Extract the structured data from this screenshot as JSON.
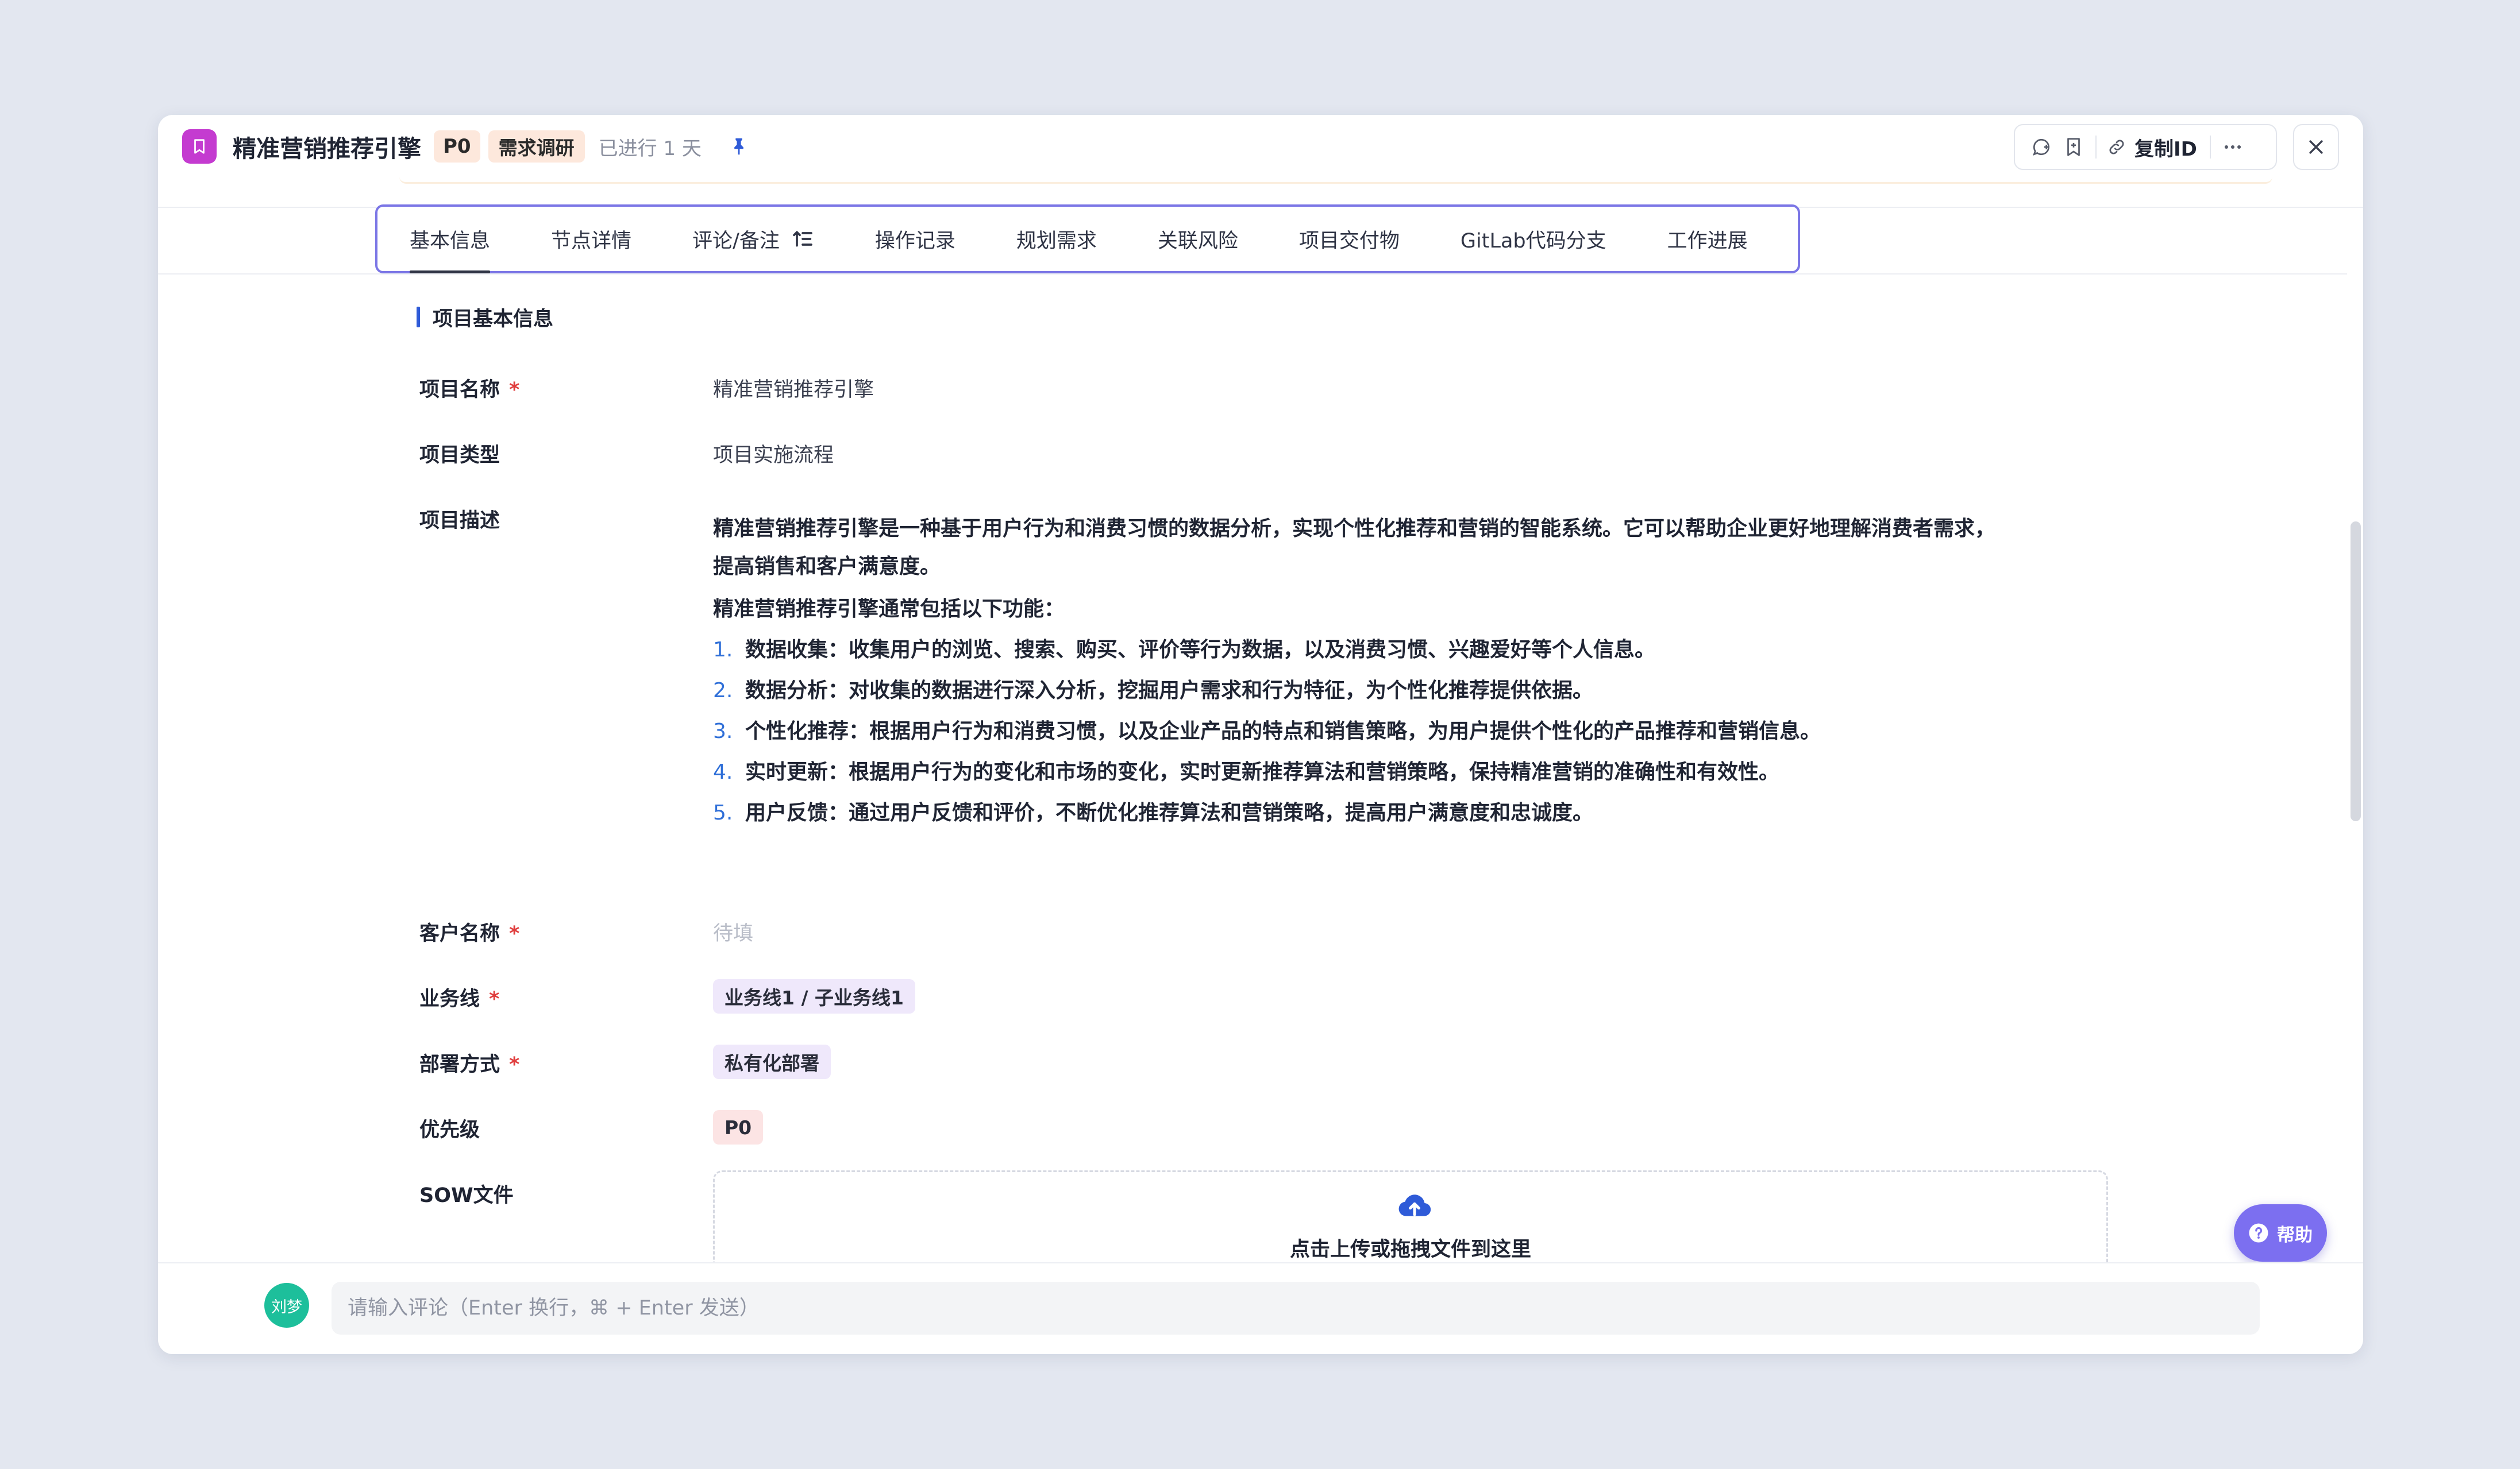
{
  "header": {
    "title": "精准营销推荐引擎",
    "priority_tag": "P0",
    "stage_tag": "需求调研",
    "elapsed": "已进行 1 天",
    "copy_id_label": "复制ID"
  },
  "tabs": [
    {
      "label": "基本信息",
      "active": true
    },
    {
      "label": "节点详情"
    },
    {
      "label": "评论/备注"
    },
    {
      "label": "操作记录"
    },
    {
      "label": "规划需求"
    },
    {
      "label": "关联风险"
    },
    {
      "label": "项目交付物"
    },
    {
      "label": "GitLab代码分支"
    },
    {
      "label": "工作进展"
    }
  ],
  "section": {
    "title": "项目基本信息"
  },
  "fields": {
    "name": {
      "label": "项目名称",
      "required": "*",
      "value": "精准营销推荐引擎"
    },
    "type": {
      "label": "项目类型",
      "value": "项目实施流程"
    },
    "description": {
      "label": "项目描述",
      "para1_line1": "精准营销推荐引擎是一种基于用户行为和消费习惯的数据分析，实现个性化推荐和营销的智能系统。它可以帮助企业更好地理解消费者需求，",
      "para1_line2": "提高销售和客户满意度。",
      "intro": "精准营销推荐引擎通常包括以下功能：",
      "items": [
        {
          "num": "1.",
          "text": "数据收集：收集用户的浏览、搜索、购买、评价等行为数据，以及消费习惯、兴趣爱好等个人信息。"
        },
        {
          "num": "2.",
          "text": "数据分析：对收集的数据进行深入分析，挖掘用户需求和行为特征，为个性化推荐提供依据。"
        },
        {
          "num": "3.",
          "text": "个性化推荐：根据用户行为和消费习惯，以及企业产品的特点和销售策略，为用户提供个性化的产品推荐和营销信息。"
        },
        {
          "num": "4.",
          "text": "实时更新：根据用户行为的变化和市场的变化，实时更新推荐算法和营销策略，保持精准营销的准确性和有效性。"
        },
        {
          "num": "5.",
          "text": "用户反馈：通过用户反馈和评价，不断优化推荐算法和营销策略，提高用户满意度和忠诚度。"
        }
      ]
    },
    "customer": {
      "label": "客户名称",
      "required": "*",
      "placeholder": "待填"
    },
    "business_line": {
      "label": "业务线",
      "required": "*",
      "value": "业务线1 / 子业务线1"
    },
    "deployment": {
      "label": "部署方式",
      "required": "*",
      "value": "私有化部署"
    },
    "priority": {
      "label": "优先级",
      "value": "P0"
    },
    "sow": {
      "label": "SOW文件",
      "upload_hint": "点击上传或拖拽文件到这里"
    }
  },
  "help": {
    "label": "帮助"
  },
  "comment": {
    "avatar_text": "刘梦",
    "placeholder": "请输入评论（Enter 换行，⌘ + Enter 发送）"
  },
  "colors": {
    "accent": "#7b76e6",
    "app_icon": "#c43bd0",
    "required": "#e03d3d",
    "list_number": "#2f6fd8",
    "avatar": "#1dbf9b",
    "help_button": "#7c6ff0"
  },
  "icons": [
    "bookmark-icon",
    "pin-icon",
    "add-comment-icon",
    "bookmark-outline-icon",
    "link-icon",
    "more-icon",
    "close-icon",
    "sort-icon",
    "upload-cloud-icon",
    "help-icon"
  ]
}
